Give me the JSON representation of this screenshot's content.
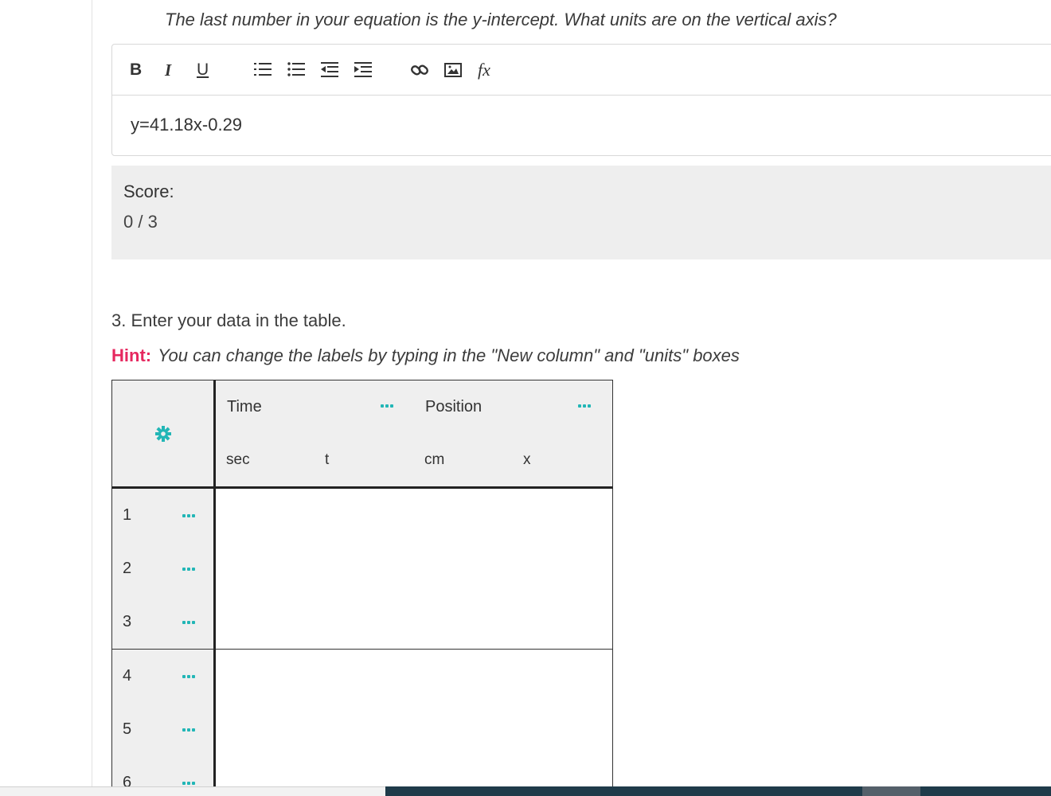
{
  "prompt": "The last number in your equation is the y-intercept. What units are on the vertical axis?",
  "editor": {
    "toolbar": {
      "bold": "B",
      "italic": "I",
      "underline": "U",
      "formula": "fx",
      "icons": [
        "numbered-list-icon",
        "bullet-list-icon",
        "outdent-icon",
        "indent-icon",
        "link-icon",
        "image-icon",
        "formula-icon"
      ]
    },
    "content": "y=41.18x-0.29"
  },
  "score": {
    "label": "Score:",
    "value": "0 / 3"
  },
  "question": {
    "title": "3. Enter your data in the table.",
    "hint_label": "Hint:",
    "hint_text": "You can change the labels by typing in the \"New column\" and \"units\" boxes"
  },
  "table": {
    "settings_icon": "gear-icon",
    "columns": [
      {
        "name": "Time",
        "units": "sec",
        "variable": "t"
      },
      {
        "name": "Position",
        "units": "cm",
        "variable": "x"
      }
    ],
    "rows": [
      "1",
      "2",
      "3",
      "4",
      "5",
      "6"
    ]
  },
  "colors": {
    "accent": "#22b6b6",
    "hint": "#e6285f",
    "score_bg": "#eeeeee",
    "bottom_bar": "#1f3b4a"
  }
}
